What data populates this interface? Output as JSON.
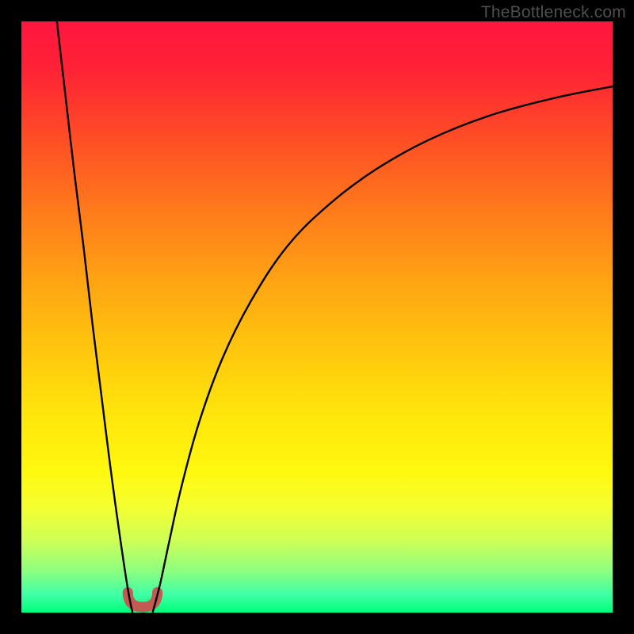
{
  "watermark": "TheBottleneck.com",
  "chart_data": {
    "type": "line",
    "title": "",
    "xlabel": "",
    "ylabel": "",
    "xlim": [
      0,
      100
    ],
    "ylim": [
      0,
      100
    ],
    "gradient_stops": [
      {
        "offset": 0.0,
        "color": "#ff163e"
      },
      {
        "offset": 0.08,
        "color": "#ff2236"
      },
      {
        "offset": 0.2,
        "color": "#ff4e25"
      },
      {
        "offset": 0.32,
        "color": "#ff7a1b"
      },
      {
        "offset": 0.44,
        "color": "#ffa413"
      },
      {
        "offset": 0.56,
        "color": "#ffc80d"
      },
      {
        "offset": 0.66,
        "color": "#ffe40b"
      },
      {
        "offset": 0.76,
        "color": "#fff80f"
      },
      {
        "offset": 0.82,
        "color": "#f6ff2f"
      },
      {
        "offset": 0.88,
        "color": "#ccff58"
      },
      {
        "offset": 0.93,
        "color": "#8dff80"
      },
      {
        "offset": 0.97,
        "color": "#3dffa6"
      },
      {
        "offset": 1.0,
        "color": "#00ff7a"
      }
    ],
    "series": [
      {
        "name": "left-branch",
        "x": [
          6.0,
          7.5,
          9.0,
          10.5,
          12.0,
          13.5,
          15.0,
          16.5,
          18.0,
          18.8
        ],
        "y": [
          100,
          87,
          74,
          62,
          49,
          37,
          25,
          14,
          4,
          0
        ]
      },
      {
        "name": "right-branch",
        "x": [
          22.2,
          23.5,
          25.0,
          27.0,
          30.0,
          34.0,
          39.0,
          45.0,
          52.0,
          60.0,
          69.0,
          79.0,
          90.0,
          100.0
        ],
        "y": [
          0,
          5,
          12,
          21,
          32,
          43,
          53,
          62,
          69,
          75,
          80,
          84,
          87,
          89
        ]
      }
    ],
    "valley_marker": {
      "shape": "u",
      "color": "#c35a53",
      "x_range": [
        18.0,
        23.0
      ],
      "y_range": [
        0,
        3
      ]
    }
  }
}
